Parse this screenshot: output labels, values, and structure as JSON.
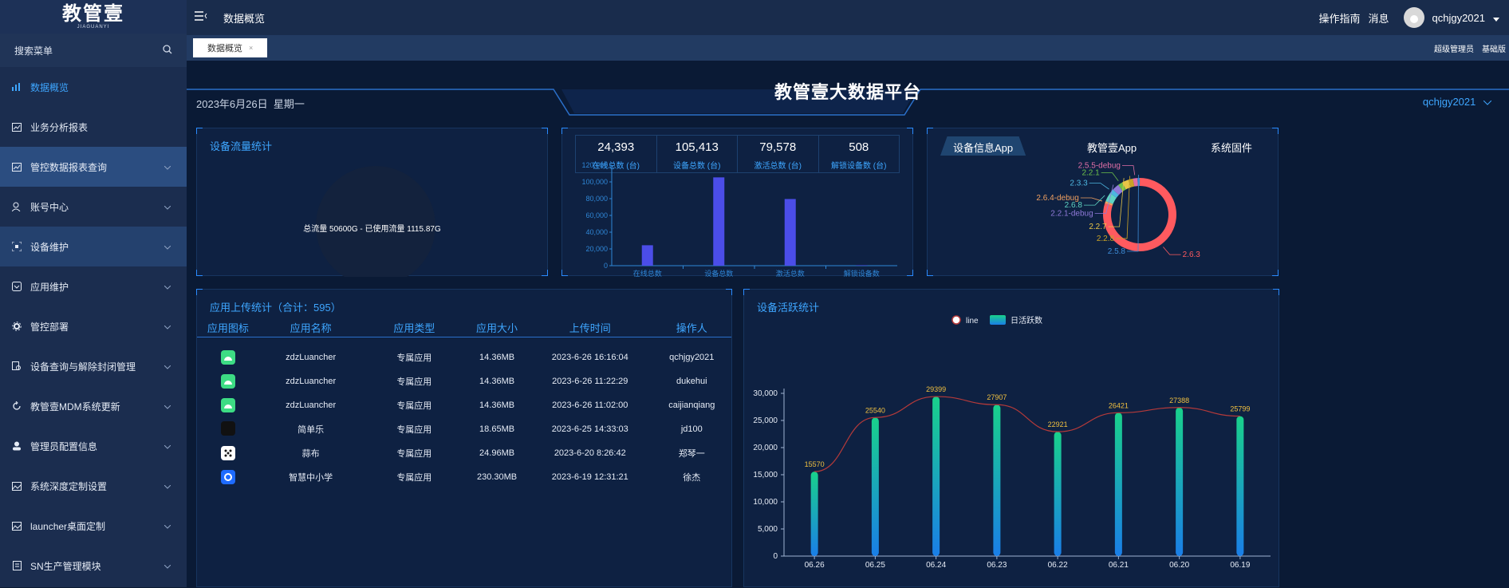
{
  "logo": {
    "title": "教管壹",
    "subtitle": "JIAGUANYI"
  },
  "sidebar": {
    "search_label": "搜索菜单",
    "items": [
      {
        "label": "数据概览"
      },
      {
        "label": "业务分析报表"
      },
      {
        "label": "管控数据报表查询"
      },
      {
        "label": "账号中心"
      },
      {
        "label": "设备维护"
      },
      {
        "label": "应用维护"
      },
      {
        "label": "管控部署"
      },
      {
        "label": "设备查询与解除封闭管理"
      },
      {
        "label": "教管壹MDM系统更新"
      },
      {
        "label": "管理员配置信息"
      },
      {
        "label": "系统深度定制设置"
      },
      {
        "label": "launcher桌面定制"
      },
      {
        "label": "SN生产管理模块"
      }
    ]
  },
  "topbar": {
    "page_title": "数据概览",
    "guide": "操作指南",
    "messages": "消息",
    "username": "qchjgy2021"
  },
  "tabbar": {
    "tab_label": "数据概览",
    "close": "×",
    "role1": "超级管理员",
    "role2": "基础版"
  },
  "dashboard": {
    "date": "2023年6月26日",
    "weekday": "星期一",
    "platform_title": "教管壹大数据平台",
    "user_select": "qchjgy2021"
  },
  "flow_panel": {
    "title": "设备流量统计",
    "summary": "总流量 50600G - 已使用流量 1115.87G"
  },
  "stats": [
    {
      "value": "24,393",
      "label": "在线总数 (台)"
    },
    {
      "value": "105,413",
      "label": "设备总数 (台)"
    },
    {
      "value": "79,578",
      "label": "激活总数 (台)"
    },
    {
      "value": "508",
      "label": "解锁设备数 (台)"
    }
  ],
  "pie_tabs": [
    "设备信息App",
    "教管壹App",
    "系统固件"
  ],
  "table_panel": {
    "title": "应用上传统计（合计：595）",
    "headers": [
      "应用图标",
      "应用名称",
      "应用类型",
      "应用大小",
      "上传时间",
      "操作人"
    ],
    "rows": [
      {
        "icon": "android-icon",
        "name": "zdzLuancher",
        "type": "专属应用",
        "size": "14.36MB",
        "time": "2023-6-26 16:16:04",
        "user": "qchjgy2021"
      },
      {
        "icon": "android-icon",
        "name": "zdzLuancher",
        "type": "专属应用",
        "size": "14.36MB",
        "time": "2023-6-26 11:22:29",
        "user": "dukehui"
      },
      {
        "icon": "android-icon",
        "name": "zdzLuancher",
        "type": "专属应用",
        "size": "14.36MB",
        "time": "2023-6-26 11:02:00",
        "user": "caijianqiang"
      },
      {
        "icon": "dark-app-icon",
        "name": "简单乐",
        "type": "专属应用",
        "size": "18.65MB",
        "time": "2023-6-25 14:33:03",
        "user": "jd100"
      },
      {
        "icon": "dice-icon",
        "name": "蒜布",
        "type": "专属应用",
        "size": "24.96MB",
        "time": "2023-6-20 8:26:42",
        "user": "郑琴一"
      },
      {
        "icon": "cloud-app-icon",
        "name": "智慧中小学",
        "type": "专属应用",
        "size": "230.30MB",
        "time": "2023-6-19 12:31:21",
        "user": "徐杰"
      }
    ]
  },
  "active_panel": {
    "title": "设备活跃统计"
  },
  "chart_data": [
    {
      "type": "pie",
      "title": "",
      "note": "donut chart of firmware versions; dominant slice 2.6.3",
      "labels": [
        "2.6.3",
        "2.6.4-debug",
        "2.6.8",
        "2.3.3",
        "2.2.1-debug",
        "2.2.1",
        "2.2.7",
        "2.2.8",
        "2.5.5-debug",
        "2.5.8"
      ],
      "values": [
        80,
        1,
        4,
        2,
        3,
        2,
        3,
        2,
        2,
        1
      ],
      "colors": [
        "#ff5a5f",
        "#f0a060",
        "#5fd3c2",
        "#4db6e0",
        "#8f79d8",
        "#6cc04a",
        "#e8c547",
        "#c9a227",
        "#e06fa6",
        "#3d8bd6"
      ]
    },
    {
      "type": "bar",
      "title": "",
      "categories": [
        "在线总数",
        "设备总数",
        "激活总数",
        "解锁设备数"
      ],
      "values": [
        24393,
        105413,
        79578,
        508
      ],
      "ylim": [
        0,
        120000
      ],
      "yticks": [
        "0",
        "20,000",
        "40,000",
        "60,000",
        "80,000",
        "100,000",
        "120,000"
      ],
      "color": "#4b4de8"
    },
    {
      "type": "bar",
      "title": "",
      "categories": [
        "06.26",
        "06.25",
        "06.24",
        "06.23",
        "06.22",
        "06.21",
        "06.20",
        "06.19"
      ],
      "series": [
        {
          "name": "line",
          "values": [
            15570,
            25540,
            29399,
            27907,
            22921,
            26421,
            27388,
            25799
          ]
        },
        {
          "name": "日活跃数",
          "values": [
            15570,
            25540,
            29399,
            27907,
            22921,
            26421,
            27388,
            25799
          ]
        }
      ],
      "ylim": [
        0,
        30000
      ],
      "yticks": [
        "0",
        "5,000",
        "10,000",
        "15,000",
        "20,000",
        "25,000",
        "30,000"
      ],
      "legend": "top-center",
      "colors": {
        "line": "#b53a3a",
        "bar_top": "#19d18b",
        "bar_bottom": "#1a7ee8",
        "label": "#f0c040"
      }
    }
  ]
}
